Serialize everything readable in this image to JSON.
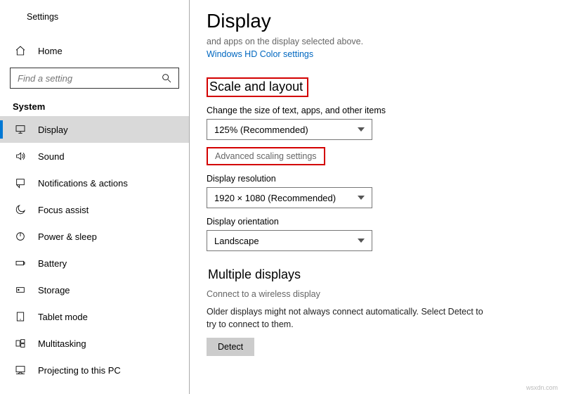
{
  "app": {
    "title": "Settings"
  },
  "home": {
    "label": "Home"
  },
  "search": {
    "placeholder": "Find a setting"
  },
  "category": "System",
  "nav": [
    {
      "label": "Display"
    },
    {
      "label": "Sound"
    },
    {
      "label": "Notifications & actions"
    },
    {
      "label": "Focus assist"
    },
    {
      "label": "Power & sleep"
    },
    {
      "label": "Battery"
    },
    {
      "label": "Storage"
    },
    {
      "label": "Tablet mode"
    },
    {
      "label": "Multitasking"
    },
    {
      "label": "Projecting to this PC"
    }
  ],
  "page": {
    "title": "Display",
    "cut_line": "and apps on the display selected above.",
    "hd_link": "Windows HD Color settings",
    "scale_heading": "Scale and layout",
    "scale_label": "Change the size of text, apps, and other items",
    "scale_value": "125% (Recommended)",
    "adv_scaling": "Advanced scaling settings",
    "res_label": "Display resolution",
    "res_value": "1920 × 1080 (Recommended)",
    "orient_label": "Display orientation",
    "orient_value": "Landscape",
    "multi_heading": "Multiple displays",
    "wireless_link": "Connect to a wireless display",
    "detect_para": "Older displays might not always connect automatically. Select Detect to try to connect to them.",
    "detect_btn": "Detect"
  },
  "watermark": "wsxdn.com"
}
